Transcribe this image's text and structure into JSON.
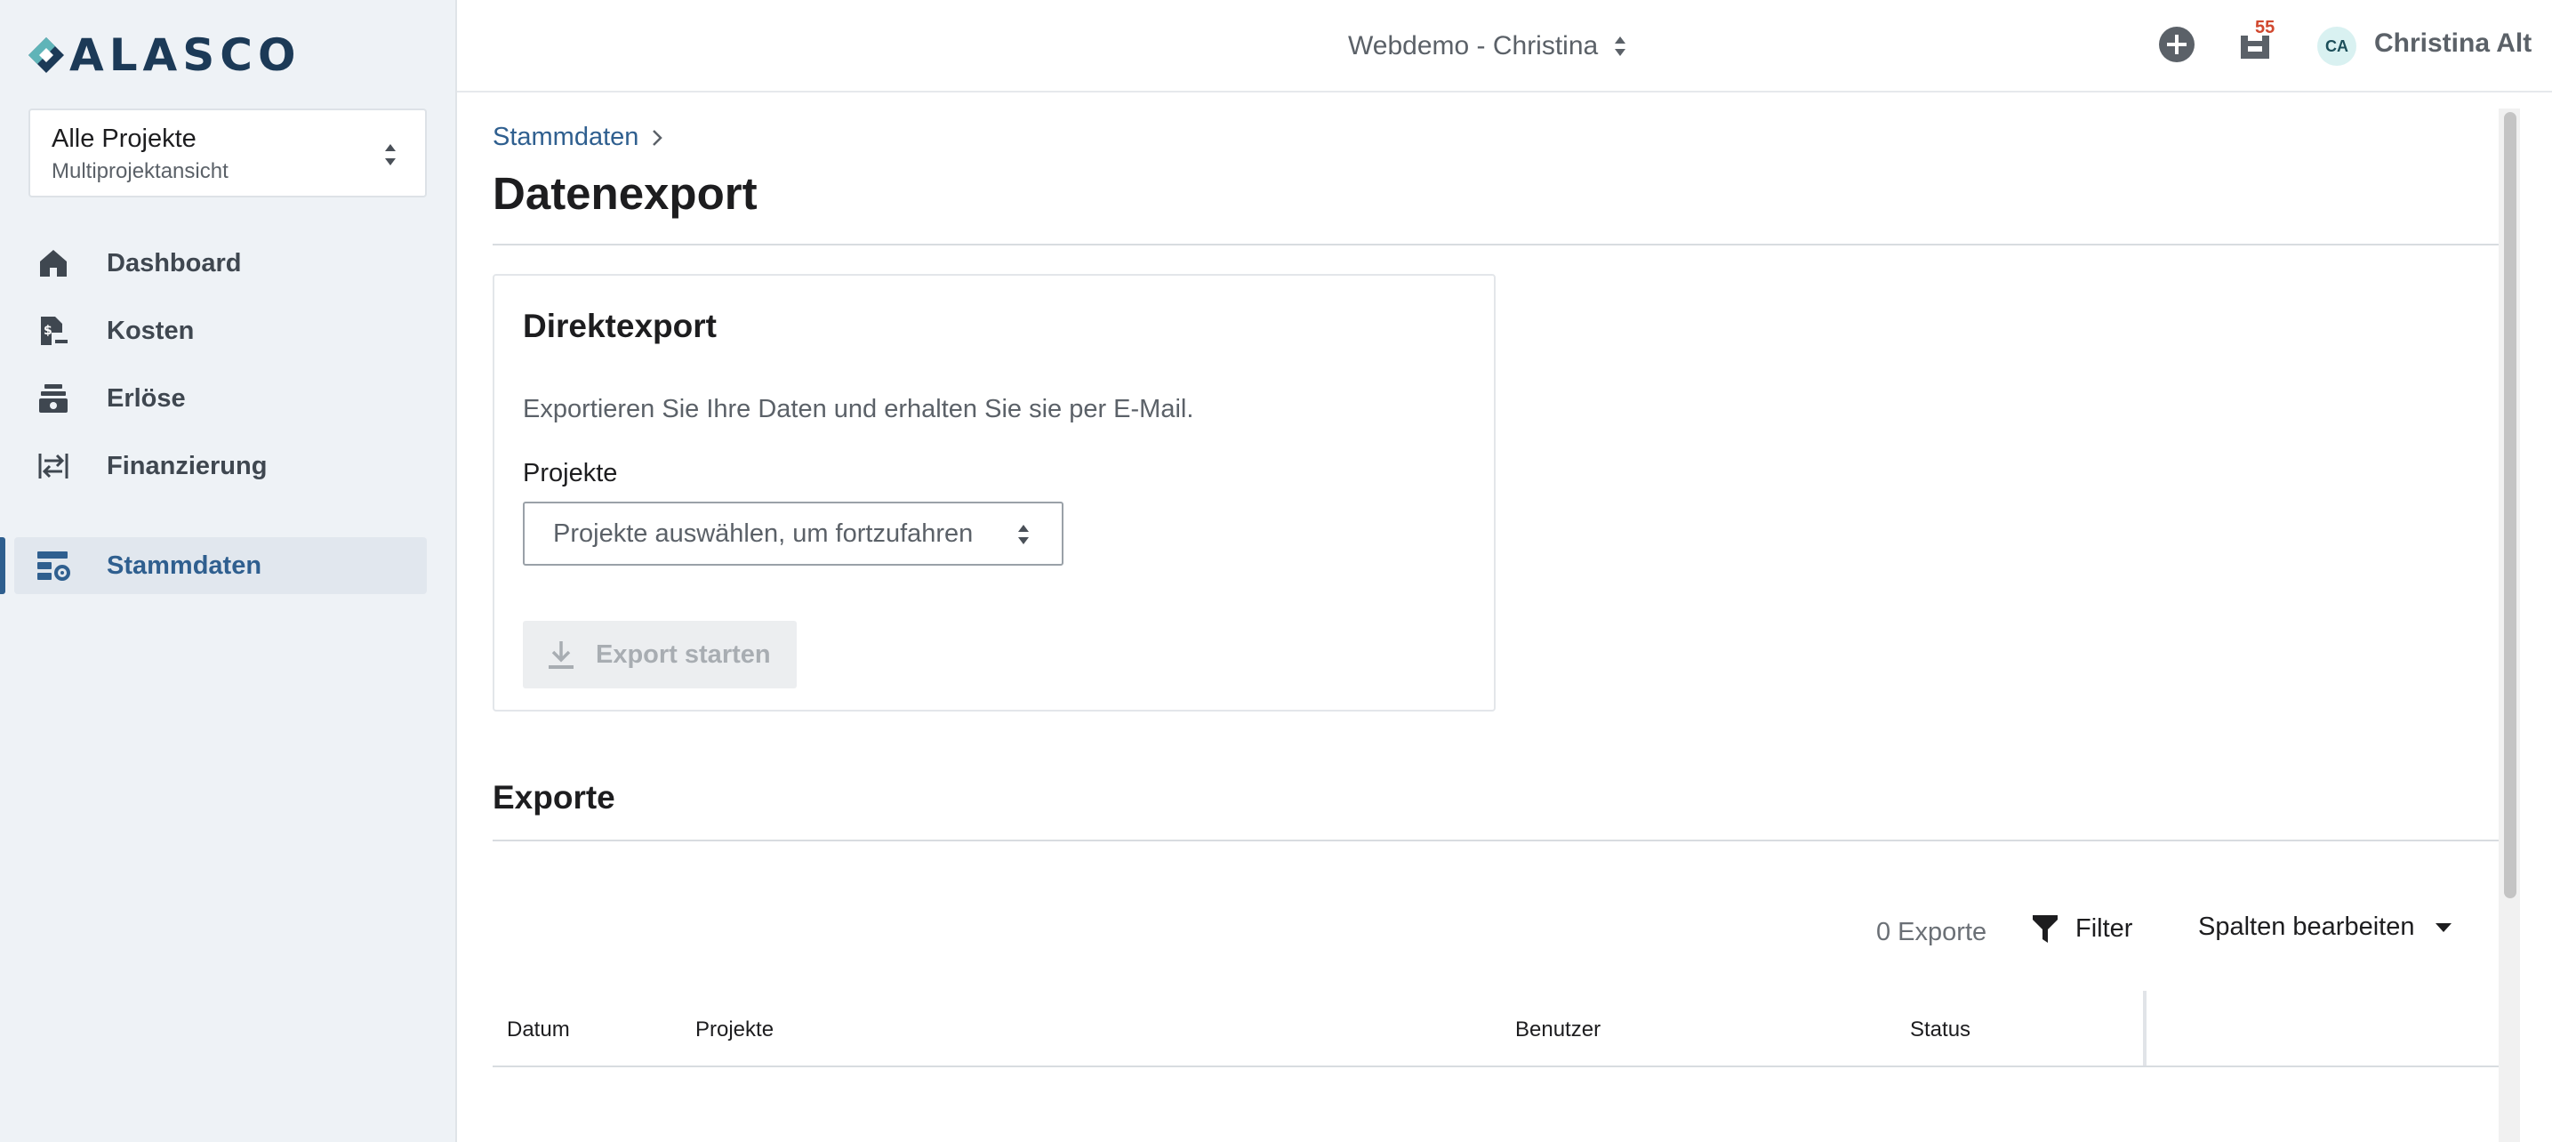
{
  "app": {
    "brand": "ALASCO"
  },
  "sidebar": {
    "project_selector": {
      "title": "Alle Projekte",
      "subtitle": "Multiprojektansicht"
    },
    "items": [
      {
        "label": "Dashboard",
        "icon": "home-icon"
      },
      {
        "label": "Kosten",
        "icon": "cost-document-icon"
      },
      {
        "label": "Erlöse",
        "icon": "cash-register-icon"
      },
      {
        "label": "Finanzierung",
        "icon": "transfer-arrows-icon"
      },
      {
        "label": "Stammdaten",
        "icon": "master-data-settings-icon",
        "active": true
      }
    ]
  },
  "topbar": {
    "organization": "Webdemo - Christina",
    "notification_count": "55",
    "user_initials": "CA",
    "user_name": "Christina Alt"
  },
  "breadcrumb": {
    "parent": "Stammdaten"
  },
  "page": {
    "title": "Datenexport"
  },
  "direct_export": {
    "title": "Direktexport",
    "description": "Exportieren Sie Ihre Daten und erhalten Sie sie per E-Mail.",
    "field_label": "Projekte",
    "select_placeholder": "Projekte auswählen, um fortzufahren",
    "button_label": "Export starten"
  },
  "exports": {
    "title": "Exporte",
    "count_label": "0 Exporte",
    "filter_label": "Filter",
    "columns_label": "Spalten bearbeiten",
    "columns": [
      "Datum",
      "Projekte",
      "Benutzer",
      "Status"
    ]
  },
  "colors": {
    "accent": "#2f5f8f",
    "sidebar_bg": "#eef2f6",
    "brand_text": "#1c3a57",
    "badge": "#d1482f"
  }
}
